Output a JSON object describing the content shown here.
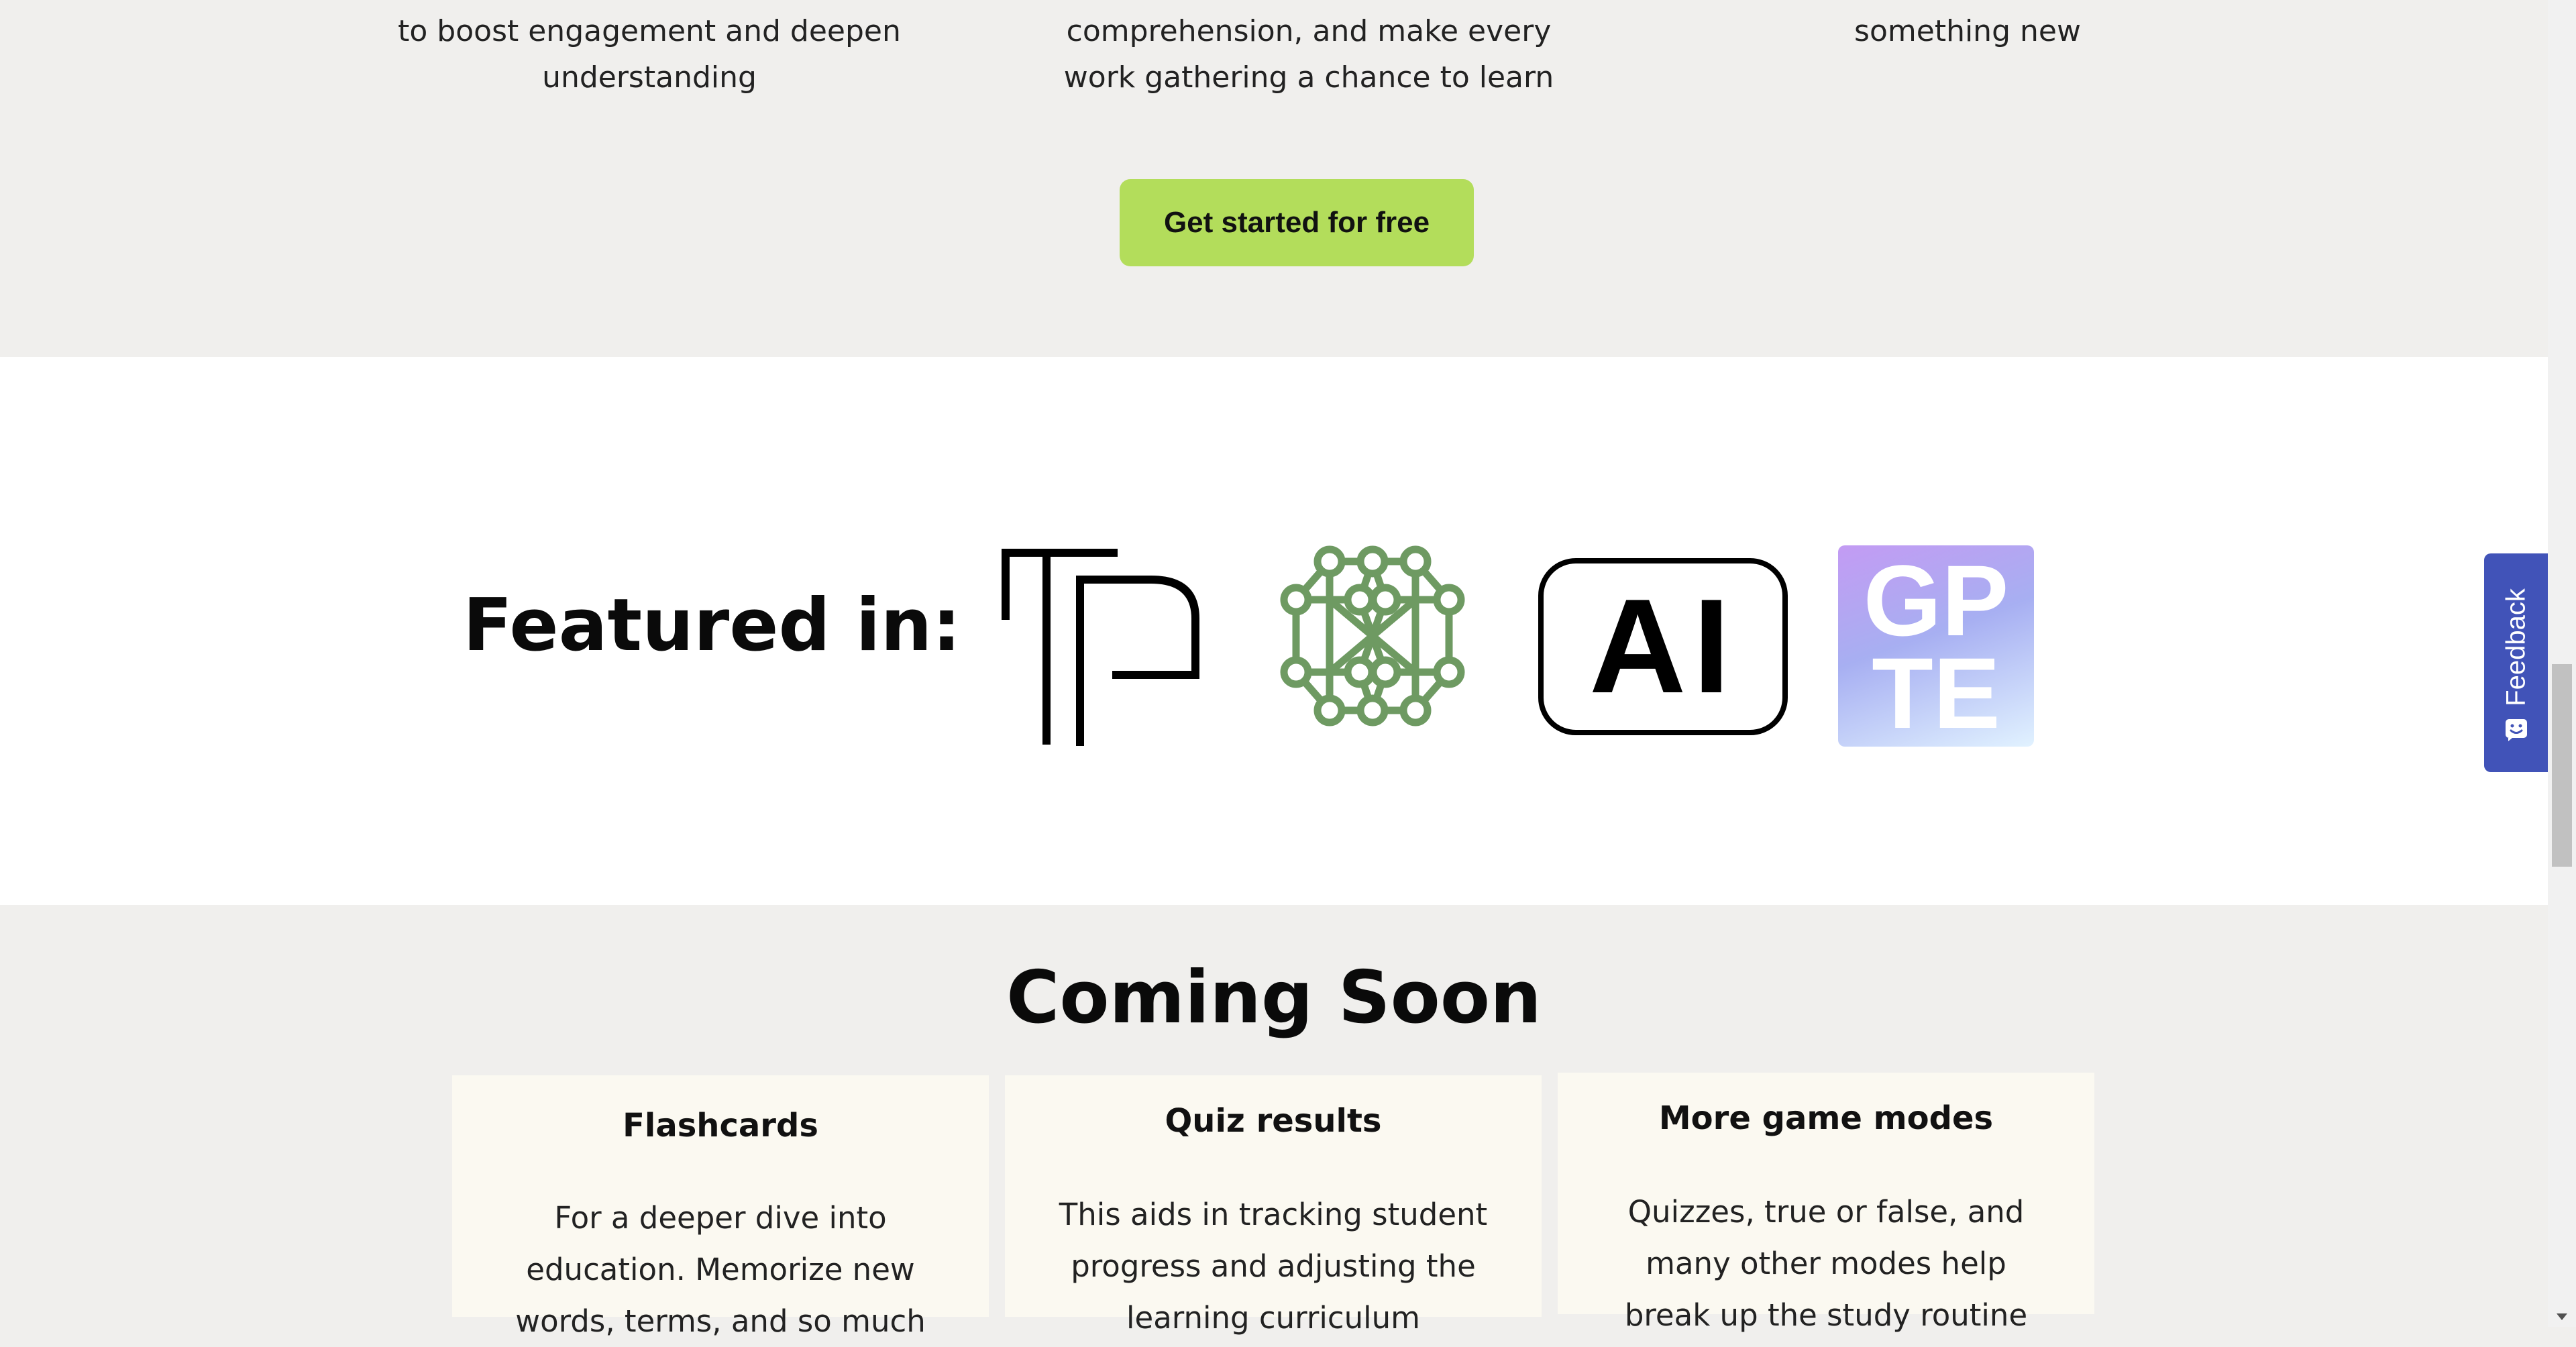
{
  "features": [
    {
      "lines": [
        "to boost engagement and deepen",
        "understanding"
      ]
    },
    {
      "lines": [
        "comprehension, and make every",
        "work gathering a chance to learn"
      ]
    },
    {
      "lines": [
        "something new"
      ]
    }
  ],
  "cta": {
    "label": "Get started for free"
  },
  "featured": {
    "title": "Featured in:",
    "logos": [
      {
        "icon": "tp-logo"
      },
      {
        "icon": "neural-network-logo"
      },
      {
        "icon": "ai-logo",
        "text": "AI"
      },
      {
        "icon": "gpte-logo",
        "text_top": "GP",
        "text_bottom": "TE"
      }
    ]
  },
  "coming_soon": {
    "title": "Coming Soon",
    "cards": [
      {
        "title": "Flashcards",
        "lines": [
          "For a deeper dive into",
          "education. Memorize new",
          "words, terms, and so much"
        ]
      },
      {
        "title": "Quiz results",
        "lines": [
          "This aids in tracking student",
          "progress and adjusting the",
          "learning curriculum"
        ]
      },
      {
        "title": "More game modes",
        "lines": [
          "Quizzes, true or false, and",
          "many other modes help",
          "break up the study routine"
        ]
      }
    ]
  },
  "feedback": {
    "label": "Feedback"
  },
  "colors": {
    "cta": "#b3dd5b",
    "feedback": "#4153b8",
    "network_green": "#6e9a62"
  }
}
